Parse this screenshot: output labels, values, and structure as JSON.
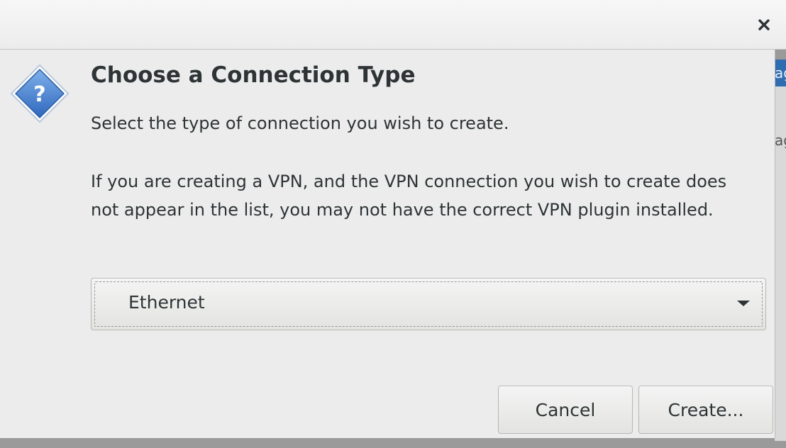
{
  "background_window": {
    "header_fragment": "ag",
    "body_fragment": "ag"
  },
  "dialog": {
    "title": "Choose a Connection Type",
    "subtitle": "Select the type of connection you wish to create.",
    "description": "If you are creating a VPN, and the VPN connection you wish to create does not appear in the list, you may not have the correct VPN plugin installed.",
    "connection_type": {
      "selected": "Ethernet"
    },
    "buttons": {
      "cancel": "Cancel",
      "create": "Create..."
    },
    "close_icon": "close-icon",
    "dialog_icon": "question-icon"
  },
  "colors": {
    "icon_blue": "#3f7fd0",
    "text": "#2e3436",
    "background_accent": "#2f6db0"
  }
}
